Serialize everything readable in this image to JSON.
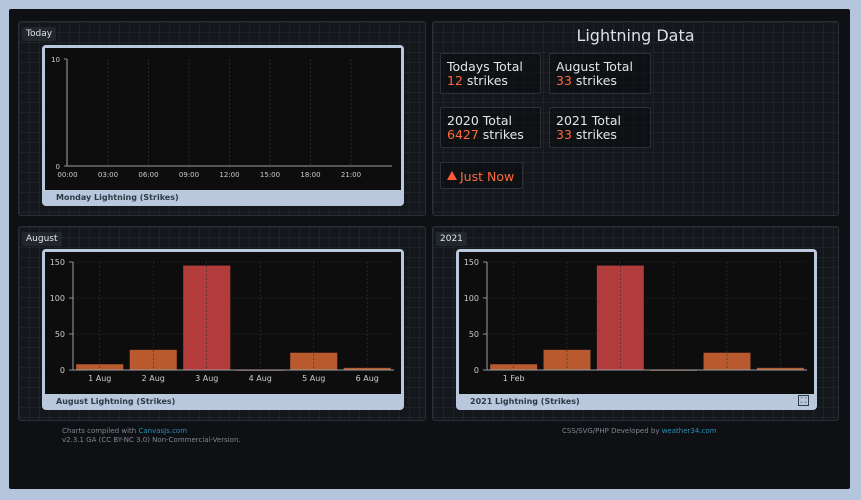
{
  "panels": {
    "today": {
      "tag": "Today",
      "caption": "Monday Lightning (Strikes)"
    },
    "august": {
      "tag": "August",
      "caption": "August Lightning (Strikes)"
    },
    "year": {
      "tag": "2021",
      "caption": "2021 Lightning (Strikes)"
    }
  },
  "lightning": {
    "title": "Lightning Data",
    "todays_label": "Todays Total",
    "todays_value": "12",
    "august_label": "August Total",
    "august_value": "33",
    "y2020_label": "2020 Total",
    "y2020_value": "6427",
    "y2021_label": "2021 Total",
    "y2021_value": "33",
    "unit": "strikes",
    "alert": "Just Now"
  },
  "footer": {
    "left_prefix": "Charts compiled with ",
    "left_link": "CanvasJs.com",
    "left_line2": "v2.3.1 GA (CC BY-NC 3.0) Non-Commercial-Version.",
    "right_prefix": "CSS/SVG/PHP Developed by ",
    "right_link": "weather34.com"
  },
  "chart_data": [
    {
      "type": "line",
      "title": "Monday Lightning (Strikes)",
      "x": [
        "00:00",
        "03:00",
        "06:00",
        "09:00",
        "12:00",
        "15:00",
        "18:00",
        "21:00"
      ],
      "y_ticks": [
        0,
        10
      ],
      "ylim": [
        0,
        10
      ],
      "values": []
    },
    {
      "type": "bar",
      "title": "August Lightning (Strikes)",
      "categories": [
        "1 Aug",
        "2 Aug",
        "3 Aug",
        "4 Aug",
        "5 Aug",
        "6 Aug"
      ],
      "values": [
        8,
        28,
        145,
        0,
        24,
        3
      ],
      "colors": [
        "#b85a2e",
        "#b85a2e",
        "#b23c3c",
        "#b85a2e",
        "#b85a2e",
        "#b85a2e"
      ],
      "y_ticks": [
        0,
        50,
        100,
        150
      ],
      "ylim": [
        0,
        150
      ]
    },
    {
      "type": "bar",
      "title": "2021 Lightning (Strikes)",
      "categories": [
        "1 Feb"
      ],
      "values": [
        8,
        28,
        145,
        0,
        24,
        3
      ],
      "colors": [
        "#b85a2e",
        "#b85a2e",
        "#b23c3c",
        "#b85a2e",
        "#b85a2e",
        "#b85a2e"
      ],
      "y_ticks": [
        0,
        50,
        100,
        150
      ],
      "ylim": [
        0,
        150
      ]
    }
  ]
}
